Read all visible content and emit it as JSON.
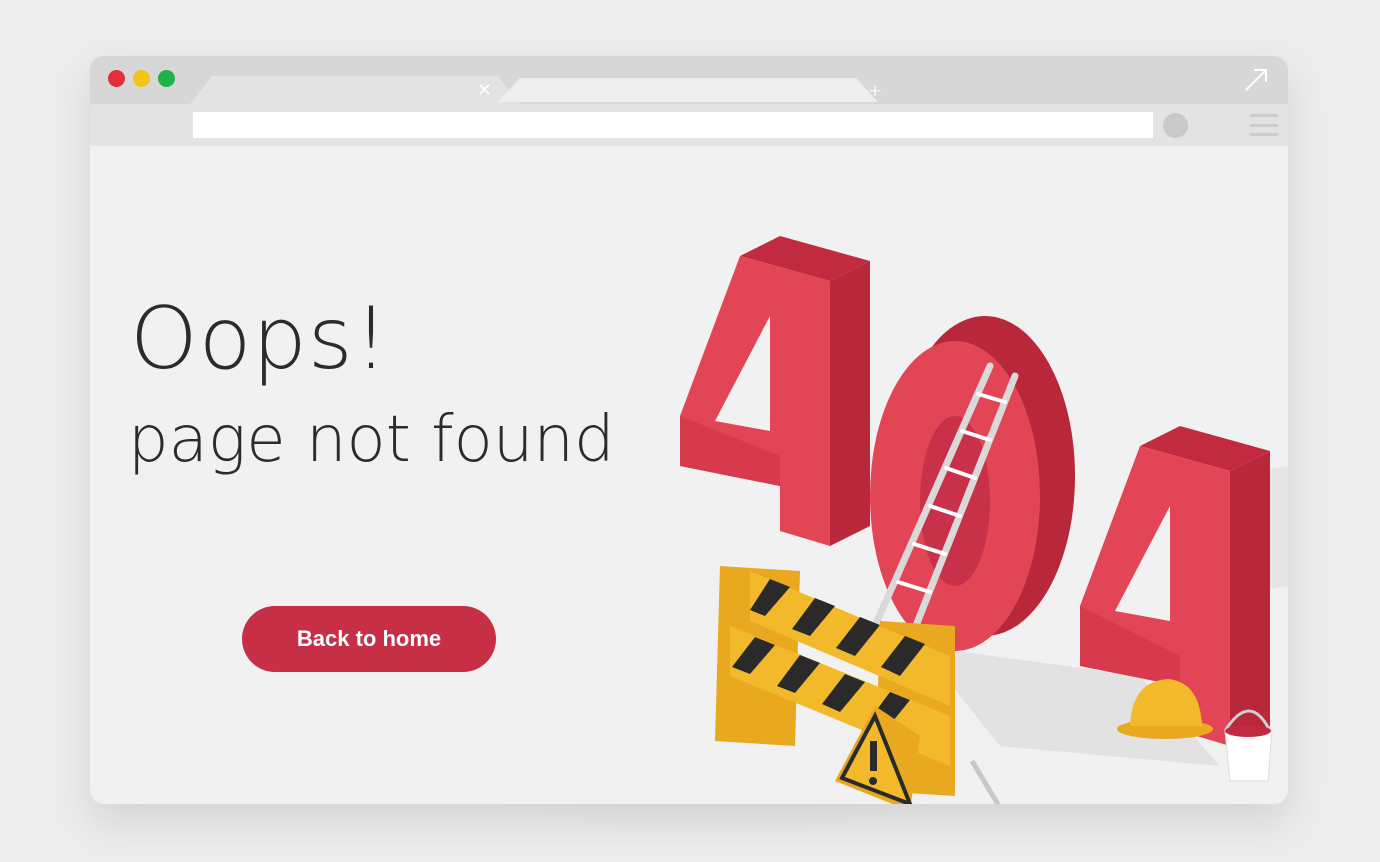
{
  "window": {
    "traffic_lights": {
      "close_color": "#e0303b",
      "minimize_color": "#f0c419",
      "maximize_color": "#1fb24a"
    },
    "tabs": [
      {
        "label": "",
        "close_icon": "close-icon"
      },
      {
        "label": ""
      }
    ],
    "new_tab_icon": "plus-icon",
    "expand_icon": "expand-arrow-icon",
    "address_bar": {
      "value": "",
      "placeholder": ""
    },
    "profile_icon": "profile-circle-icon",
    "menu_icon": "hamburger-menu-icon"
  },
  "page": {
    "headline": "Oops!",
    "subheadline": "page not found",
    "back_button_label": "Back to home",
    "error_code": "404",
    "colors": {
      "accent": "#c62f45",
      "digit_front": "#e24556",
      "digit_side": "#b8273a",
      "barrier_yellow": "#f2b92b",
      "text": "#2b2b2b"
    },
    "illustration_items": [
      "ladder",
      "road-barrier",
      "warning-sign",
      "hard-hat",
      "paint-bucket",
      "wrench"
    ]
  }
}
